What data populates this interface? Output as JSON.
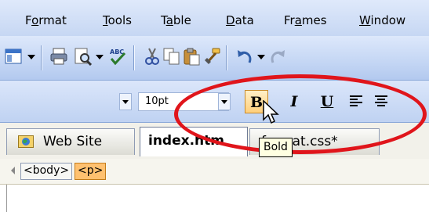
{
  "menubar": {
    "items": [
      {
        "pre": "F",
        "ul": "o",
        "post": "rmat"
      },
      {
        "pre": "",
        "ul": "T",
        "post": "ools"
      },
      {
        "pre": "T",
        "ul": "a",
        "post": "ble"
      },
      {
        "pre": "",
        "ul": "D",
        "post": "ata"
      },
      {
        "pre": "Fr",
        "ul": "a",
        "post": "mes"
      },
      {
        "pre": "",
        "ul": "W",
        "post": "indow"
      }
    ]
  },
  "format_toolbar": {
    "font_size": "10pt",
    "bold_label": "B",
    "italic_label": "I",
    "underline_label": "U",
    "tooltip": "Bold"
  },
  "tabs": {
    "items": [
      {
        "label": "Web Site"
      },
      {
        "label": "index.htm"
      },
      {
        "label": "format.css*"
      }
    ]
  },
  "tagbar": {
    "tags": [
      "<body>",
      "<p>"
    ]
  },
  "colors": {
    "highlight_circle": "#e0151b",
    "bold_active_bg": "#ffcf7a",
    "selected_tag_bg": "#ffc170"
  }
}
